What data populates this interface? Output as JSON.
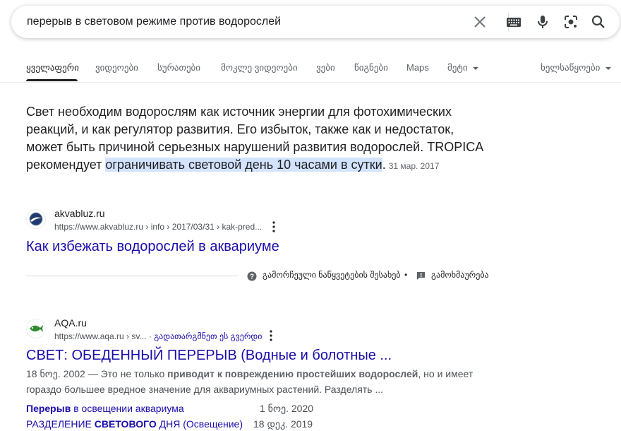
{
  "search": {
    "query": "перерыв в световом режиме против водорослей"
  },
  "tabs": {
    "items": [
      "ყველაფერი",
      "ვიდეოები",
      "სურათები",
      "მოკლე ვიდეოები",
      "ვები",
      "წიგნები",
      "Maps",
      "მეტი"
    ],
    "tools": "ხელსაწყოები"
  },
  "snippet": {
    "text_before": "Свет необходим водорослям как источник энергии для фотохимических реакций, и как регулятор развития. Его избыток, также как и недостаток, может быть причиной серьезных нарушений развития водорослей. TROPICA рекомендует ",
    "highlight": "ограничивать световой день 10 часами в сутки",
    "text_after": ".",
    "date": "31 мар. 2017"
  },
  "result1": {
    "site": "akvabluz.ru",
    "url": "https://www.akvabluz.ru › info › 2017/03/31 › kak-pred...",
    "title": "Как избежать водорослей в аквариуме"
  },
  "about": {
    "featured": "გამორჩეული ნაწყვეტების შესახებ",
    "separator": "•",
    "feedback": "გამოხმაურება"
  },
  "result2": {
    "site": "AQA.ru",
    "url": "https://www.aqa.ru › sv...",
    "url_sep": "·",
    "translate": "გადათარგმნეთ ეს გვერდი",
    "title": "СВЕТ: ОБЕДЕННЫЙ ПЕРЕРЫВ (Водные и болотные ...",
    "desc_date": "18 ნოე. 2002",
    "desc_dash": " — ",
    "desc_1": "Это не только ",
    "desc_bold": "приводит к повреждению простейших водорослей",
    "desc_2": ", но и имеет гораздо большее вредное значение для аквариумных растений. Разделять ...",
    "sublinks": [
      {
        "bold": "Перерыв",
        "rest": " в освещении аквариума",
        "date": "1 ნოე. 2020"
      },
      {
        "pre": "РАЗДЕЛЕНИЕ ",
        "bold": "СВЕТОВОГО",
        "rest": " ДНЯ (Освещение)",
        "date": "18 დეკ. 2019"
      }
    ]
  },
  "colors": {
    "link": "#1a0dab",
    "highlight": "#d3e3fd",
    "secondary_text": "#5f6368"
  }
}
